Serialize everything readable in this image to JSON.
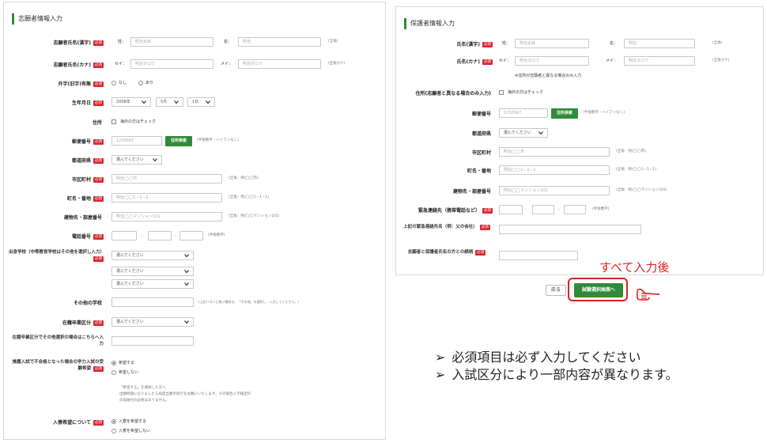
{
  "left": {
    "title": "志願者情報入力",
    "req": "必須",
    "name_kanji": {
      "label": "志願者氏名(漢字)",
      "sei": "姓：",
      "mei": "名：",
      "sei_ph": "明治太郎",
      "mei_ph": "明治",
      "note": "(全角)"
    },
    "name_kana": {
      "label": "志願者氏名(カナ)",
      "sei": "セイ：",
      "mei": "メイ：",
      "sei_ph": "明治タロウ",
      "mei_ph": "明治タロウ",
      "note": "(全角カナ)"
    },
    "gaiji": {
      "label": "外字(旧字)有無",
      "opt1": "なし",
      "opt2": "あり"
    },
    "birth": {
      "label": "生年月日",
      "year": "2008年",
      "month": "5月",
      "day": "1日"
    },
    "address": {
      "label": "住所",
      "check": "海外の方はチェック"
    },
    "zip": {
      "label": "郵便番号",
      "ph": "1230567",
      "button": "住所検索",
      "note": "(半角数字・ハイフンなし)"
    },
    "pref": {
      "label": "都道府県",
      "value": "選んでください"
    },
    "city": {
      "label": "市区町村",
      "ph": "明治◯◯市",
      "note": "(全角：例)◯◯市)"
    },
    "town": {
      "label": "町名・番地",
      "ph": "明治◯◯1－1－1",
      "note": "(全角：例)◯◯1－1－1)"
    },
    "building": {
      "label": "建物名・部屋番号",
      "ph": "明治◯◯マンション101",
      "note": "(全角：例)◯◯マンション101)"
    },
    "phone": {
      "label": "電話番号",
      "note": "(半角数字)"
    },
    "school": {
      "label": "出身学校（中等教育学校はその他を選択し入力）",
      "value": "選んでください"
    },
    "other_school": {
      "label": "その他の学校",
      "note": "(上記リストに無い場合は、「その他」を選択し、入力してください。)"
    },
    "status": {
      "label": "在籍卒業区分",
      "value": "選んでください"
    },
    "status_other": {
      "label": "在籍卒業区分でその他選択の場合はこちらへ入力"
    },
    "hope": {
      "label": "推薦入試で不合格となった場合の学力入試の受験希望",
      "opt1": "希望する",
      "opt2": "希望しない",
      "note1": "「希望する」を選択した方へ",
      "note2": "出願時間になりましたら再度出願手続きをお願いいたします。その場合入学検定料",
      "note3": "の再納付の必要はありません。"
    },
    "dorm": {
      "label": "入寮希望について",
      "opt1": "入寮を希望する",
      "opt2": "入寮を希望しない"
    }
  },
  "right": {
    "title": "保護者情報入力",
    "name_kanji": {
      "label": "氏名(漢字)",
      "sei": "姓：",
      "mei": "名：",
      "sei_ph": "明治太郎",
      "mei_ph": "明治",
      "note": "(全角)"
    },
    "name_kana": {
      "label": "氏名(カナ)",
      "sei": "セイ：",
      "mei": "メイ：",
      "sei_ph": "明治タロウ",
      "mei_ph": "明治タロウ",
      "note": "(全角カナ)"
    },
    "addr_note": "※住所が志願者と異なる場合のみ入力",
    "address": {
      "label": "住所(志願者と異なる場合のみ入力)",
      "check": "海外の方はチェック"
    },
    "zip": {
      "label": "郵便番号",
      "ph": "1230567",
      "button": "住所検索",
      "note": "(半角数字・ハイフンなし)"
    },
    "pref": {
      "label": "都道府県",
      "value": "選んでください"
    },
    "city": {
      "label": "市区町村",
      "ph": "明治◯◯市",
      "note": "(全角：例)◯◯市)"
    },
    "town": {
      "label": "町名・番地",
      "ph": "明治◯◯1－1－1",
      "note": "(全角：例)◯◯1－1－1)"
    },
    "building": {
      "label": "建物名・部屋番号",
      "ph": "明治◯◯マンション101",
      "note": "(全角：例)◯◯マンション101)"
    },
    "emergency": {
      "label": "緊急連絡先（携帯電話など）",
      "note": "(半角数字)"
    },
    "emergency_name": {
      "label": "上記の緊急連絡先名（例：父の会社）"
    },
    "relation": {
      "label": "志願者と保護者氏名の方との続柄"
    }
  },
  "actions": {
    "back": "戻る",
    "next": "試験選択画面へ"
  },
  "annotation": {
    "text": "すべて入力後"
  },
  "bullets": [
    "必須項目は必ず入力してください",
    "入試区分により一部内容が異なります。"
  ],
  "colors": {
    "accent_green": "#2f8b3a",
    "required_red": "#d9262e",
    "annotation_red": "#e02020"
  },
  "icons": {
    "pointing_hand": "pointing-hand-icon",
    "chevron": "chevron-down-icon"
  }
}
